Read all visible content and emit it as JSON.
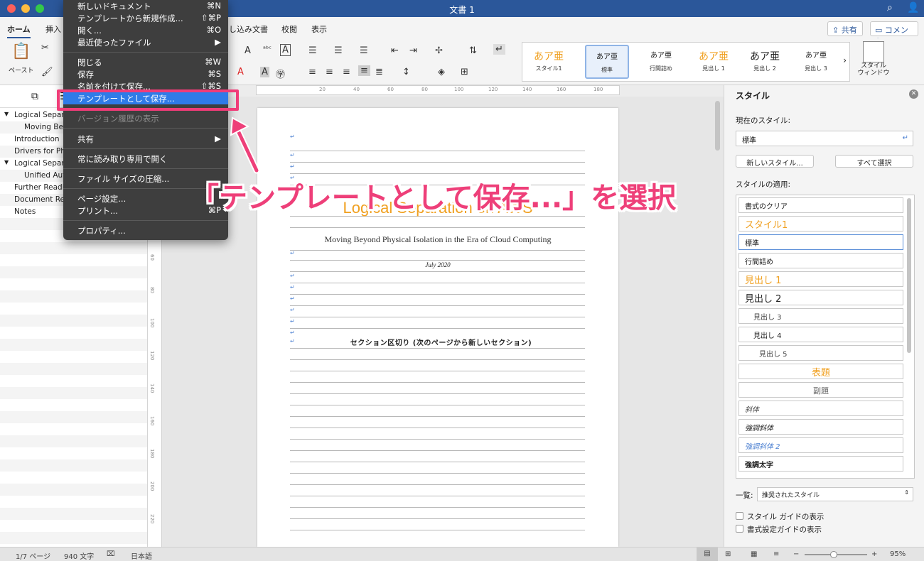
{
  "window": {
    "title": "文書 1"
  },
  "ribbon": {
    "tabs": [
      "ホーム",
      "挿入",
      "し込み文書",
      "校閲",
      "表示"
    ],
    "share_label": "共有",
    "comment_label": "コメント",
    "paste_label": "ペースト",
    "style_window_label": "スタイル\nウィンドウ",
    "gallery": [
      {
        "sample": "あア亜",
        "name": "スタイル1"
      },
      {
        "sample": "あア亜",
        "name": "標準"
      },
      {
        "sample": "あア亜",
        "name": "行間詰め"
      },
      {
        "sample": "あア亜",
        "name": "見出し 1"
      },
      {
        "sample": "あア亜",
        "name": "見出し 2"
      },
      {
        "sample": "あア亜",
        "name": "見出し 3"
      }
    ]
  },
  "nav": {
    "items": [
      {
        "label": "Logical Separ",
        "level": 0,
        "expanded": true
      },
      {
        "label": "Moving Bey",
        "level": 1
      },
      {
        "label": "Introduction",
        "level": 0
      },
      {
        "label": "Drivers for Ph",
        "level": 0
      },
      {
        "label": "Logical Separ",
        "level": 0,
        "expanded": true
      },
      {
        "label": "Unified Aut",
        "level": 1
      },
      {
        "label": "Further Readi",
        "level": 0
      },
      {
        "label": "Document Re",
        "level": 0
      },
      {
        "label": "Notes",
        "level": 0
      }
    ]
  },
  "document": {
    "title": "Logical Separation on AWS",
    "subtitle": "Moving Beyond Physical Isolation in the Era of Cloud Computing",
    "date": "July 2020",
    "section_break": "セクション区切り (次のページから新しいセクション)"
  },
  "ruler": {
    "h_ticks": [
      "20",
      "40",
      "60",
      "80",
      "100",
      "120",
      "140",
      "160",
      "180"
    ],
    "v_ticks": [
      "60",
      "80",
      "100",
      "120",
      "140",
      "160",
      "180",
      "200",
      "220"
    ]
  },
  "styles_pane": {
    "title": "スタイル",
    "current_label": "現在のスタイル:",
    "current_value": "標準",
    "new_style_button": "新しいスタイル...",
    "select_all_button": "すべて選択",
    "apply_label": "スタイルの適用:",
    "styles": [
      {
        "label": "書式のクリア",
        "color": "#222222"
      },
      {
        "label": "スタイル1",
        "color": "#f0a020"
      },
      {
        "label": "標準",
        "color": "#222222"
      },
      {
        "label": "行間詰め",
        "color": "#222222"
      },
      {
        "label": "見出し 1",
        "color": "#f0a020"
      },
      {
        "label": "見出し 2",
        "color": "#222222"
      },
      {
        "label": "見出し 3",
        "color": "#444444"
      },
      {
        "label": "見出し 4",
        "color": "#222222"
      },
      {
        "label": "見出し 5",
        "color": "#444444"
      },
      {
        "label": "表題",
        "color": "#f0a020"
      },
      {
        "label": "副題",
        "color": "#666666"
      },
      {
        "label": "斜体",
        "color": "#444444"
      },
      {
        "label": "強調斜体",
        "color": "#222222"
      },
      {
        "label": "強調斜体 2",
        "color": "#4a7fd1"
      },
      {
        "label": "強調太字",
        "color": "#222222"
      }
    ],
    "list_label": "一覧:",
    "list_value": "推奨されたスタイル",
    "show_style_guide": "スタイル ガイドの表示",
    "show_format_guide": "書式設定ガイドの表示"
  },
  "status": {
    "page": "1/7 ページ",
    "words": "940 文字",
    "language": "日本語",
    "zoom": "95%"
  },
  "file_menu": {
    "items": [
      {
        "label": "新しいドキュメント",
        "shortcut": "⌘N"
      },
      {
        "label": "テンプレートから新規作成...",
        "shortcut": "⇧⌘P"
      },
      {
        "label": "開く...",
        "shortcut": "⌘O"
      },
      {
        "label": "最近使ったファイル",
        "shortcut": "▶"
      },
      {
        "label": "閉じる",
        "shortcut": "⌘W"
      },
      {
        "label": "保存",
        "shortcut": "⌘S"
      },
      {
        "label": "名前を付けて保存...",
        "shortcut": "⇧⌘S"
      },
      {
        "label": "テンプレートとして保存...",
        "shortcut": ""
      },
      {
        "label": "バージョン履歴の表示",
        "shortcut": ""
      },
      {
        "label": "共有",
        "shortcut": "▶"
      },
      {
        "label": "常に読み取り専用で開く",
        "shortcut": ""
      },
      {
        "label": "ファイル サイズの圧縮...",
        "shortcut": ""
      },
      {
        "label": "ページ設定...",
        "shortcut": ""
      },
      {
        "label": "プリント...",
        "shortcut": "⌘P"
      },
      {
        "label": "プロパティ...",
        "shortcut": ""
      }
    ]
  },
  "annotation": {
    "callout": "「テンプレートとして保存...」を選択",
    "color": "#ee3f79"
  }
}
